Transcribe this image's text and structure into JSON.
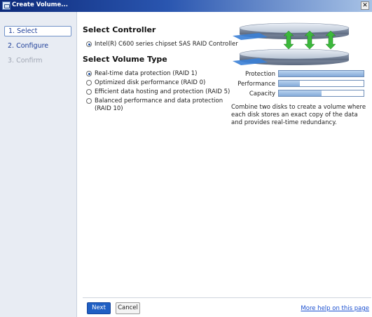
{
  "window": {
    "title": "Create Volume...",
    "close_glyph": "✕"
  },
  "sidebar": {
    "steps": [
      {
        "label": "1. Select",
        "state": "active"
      },
      {
        "label": "2. Configure",
        "state": "normal"
      },
      {
        "label": "3. Confirm",
        "state": "disabled"
      }
    ]
  },
  "controller_section": {
    "heading": "Select Controller",
    "options": [
      {
        "label": "Intel(R) C600 series chipset SAS RAID Controller",
        "checked": true
      }
    ]
  },
  "volume_section": {
    "heading": "Select Volume Type",
    "options": [
      {
        "label": "Real-time data protection (RAID 1)",
        "checked": true
      },
      {
        "label": "Optimized disk performance (RAID 0)",
        "checked": false
      },
      {
        "label": "Efficient data hosting and protection (RAID 5)",
        "checked": false
      },
      {
        "label": "Balanced performance and data protection (RAID 10)",
        "checked": false
      }
    ]
  },
  "meters": [
    {
      "label": "Protection",
      "level": 1.0
    },
    {
      "label": "Performance",
      "level": 0.25
    },
    {
      "label": "Capacity",
      "level": 0.5
    }
  ],
  "description": "Combine two disks to create a volume where each disk stores an exact copy of the data and provides real-time redundancy.",
  "footer": {
    "next_label": "Next",
    "cancel_label": "Cancel",
    "help_link": "More help on this page"
  },
  "colors": {
    "accent": "#1f5fc4",
    "title_bar": "#0d2a7a",
    "sync_arrows": "#3cb83c"
  },
  "icons": {
    "app": "disk-volume-icon",
    "close": "close-icon",
    "illustration": "raid-mirror-disks-illustration"
  }
}
